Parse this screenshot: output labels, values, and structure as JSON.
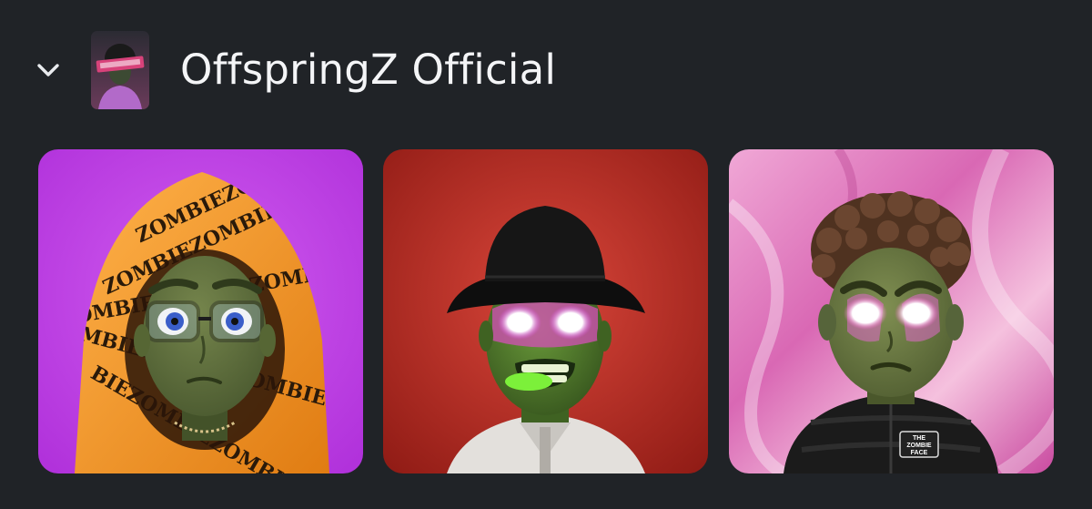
{
  "collection": {
    "title": "OffspringZ Official",
    "avatar_icon": "offspringz-logo-avatar",
    "collapse_icon": "chevron-down-icon"
  },
  "cards": [
    {
      "art": "zombie-orange-hoodie-glasses",
      "hood_text": [
        "ZOMBIEZOMBIEZOMBIE",
        "ZOMBIEZOMBIEZOMBIE",
        "OMBIEZOMBIEZOMBIEZ",
        "MBIEZOMBIEZOMBIEZO",
        "BIEZOMBIEZOMBIEZOM"
      ],
      "colors": {
        "background": "#c43ee6",
        "hood": "#f39a26",
        "skin": "#5f6f3e"
      }
    },
    {
      "art": "zombie-bucket-hat-glowing-eyes",
      "colors": {
        "background": "#b8291f",
        "hat": "#111111",
        "skin": "#4e7a2c"
      }
    },
    {
      "art": "zombie-curly-hair-puffer-jacket",
      "jacket_logo": [
        "THE",
        "ZOMBIE",
        "FACE"
      ],
      "colors": {
        "background": "#e58bc3",
        "hair": "#5a3a25",
        "skin": "#6e7d43"
      }
    }
  ]
}
